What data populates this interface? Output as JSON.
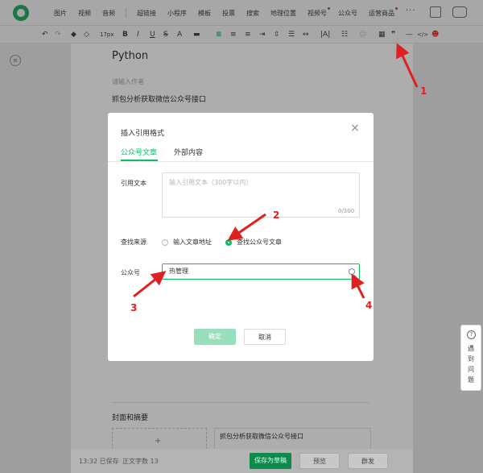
{
  "topbar": {
    "menu": [
      {
        "label": "图片",
        "dot": false
      },
      {
        "label": "视频",
        "dot": false
      },
      {
        "label": "音频",
        "dot": false
      },
      {
        "sep": true
      },
      {
        "label": "超链接",
        "dot": false
      },
      {
        "label": "小程序",
        "dot": false
      },
      {
        "label": "模板",
        "dot": false
      },
      {
        "label": "投票",
        "dot": false
      },
      {
        "label": "搜索",
        "dot": false
      },
      {
        "label": "地理位置",
        "dot": false
      },
      {
        "label": "视频号",
        "dot": true
      },
      {
        "label": "公众号",
        "dot": false
      },
      {
        "label": "运营商品",
        "dot": true
      }
    ],
    "more": "···"
  },
  "toolbar": {
    "font_size": "17px"
  },
  "editor": {
    "title": "Python",
    "author_placeholder": "请输入作者",
    "digest": "抓包分析获取微信公众号接口",
    "cover_label": "封面和摘要",
    "cover_plus": "+",
    "digest_box": "抓包分析获取微信公众号接口"
  },
  "bottombar": {
    "saved_time": "13:32 已保存",
    "word_count": "正文字数 13",
    "save_draft": "保存为草稿",
    "preview": "预览",
    "publish": "群发"
  },
  "modal": {
    "title": "插入引用格式",
    "close": "×",
    "tabs": [
      {
        "label": "公众号文章",
        "active": true
      },
      {
        "label": "外部内容",
        "active": false
      }
    ],
    "quote_label": "引用文本",
    "quote_placeholder": "输入引用文本（300字以内）",
    "counter": "0/300",
    "source_label": "查找来源",
    "radio_url": "输入文章地址",
    "radio_account": "查找公众号文章",
    "account_label": "公众号",
    "account_value": "热管理",
    "confirm": "确定",
    "cancel": "取消"
  },
  "help": {
    "icon": "?",
    "text": "遇到问题"
  },
  "annotations": [
    "1",
    "2",
    "3",
    "4"
  ],
  "colors": {
    "accent": "#07c160",
    "annotation": "#e02020"
  }
}
